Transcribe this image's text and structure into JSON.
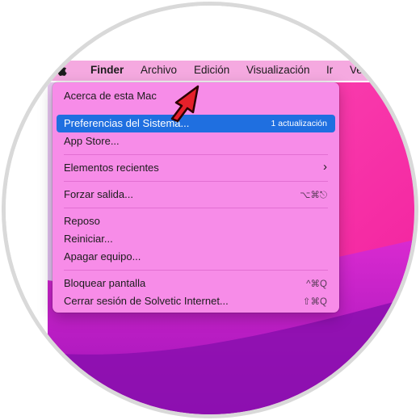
{
  "menubar": {
    "app_name": "Finder",
    "items": [
      "Archivo",
      "Edición",
      "Visualización",
      "Ir",
      "Ver"
    ]
  },
  "apple_menu": {
    "about": "Acerca de esta Mac",
    "system_prefs": "Preferencias del Sistema...",
    "system_prefs_badge": "1 actualización",
    "app_store": "App Store...",
    "recent_items": "Elementos recientes",
    "force_quit": "Forzar salida...",
    "force_quit_shortcut": "⌥⌘⎋",
    "sleep": "Reposo",
    "restart": "Reiniciar...",
    "shutdown": "Apagar equipo...",
    "lock_screen": "Bloquear pantalla",
    "lock_screen_shortcut": "^⌘Q",
    "log_out": "Cerrar sesión de Solvetic Internet...",
    "log_out_shortcut": "⇧⌘Q"
  },
  "colors": {
    "menubar": "#f5a9e0",
    "menu_background": "#f78ce8",
    "selection": "#1f6fe0",
    "pointer_arrow": "#e5202a"
  }
}
